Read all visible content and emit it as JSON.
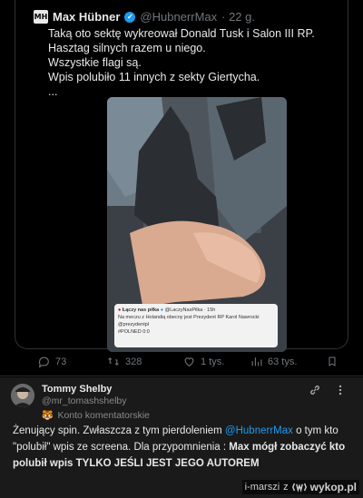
{
  "quoted": {
    "logo_text": "MH",
    "author": "Max Hübner",
    "handle": "@HubnerrMax",
    "time": "· 22 g.",
    "lines": [
      "Taką oto sektę wykreował Donald Tusk i Salon III RP.",
      "Hasztag silnych razem u niego.",
      "Wszystkie flagi są.",
      "Wpis polubiło 11 innych z sekty Giertycha.",
      "..."
    ]
  },
  "photo_card": {
    "author": "Łączy nas piłka",
    "handle": "@LaczyNasPilka · 15h",
    "text": "Na meczu z Holandią obecny jest Prezydent RP Karol Nawrocki @prezydentpl",
    "tag": "#POLNED 0:0"
  },
  "actions": {
    "replies": "73",
    "reposts": "328",
    "likes": "1 tys.",
    "views": "63 tys."
  },
  "comment": {
    "author": "Tommy Shelby",
    "handle": "@mr_tomashshelby",
    "account_type": "Konto komentatorskie",
    "text_1": "Żenujący spin. Zwłaszcza z tym pierdoleniem ",
    "mention": "@HubnerrMax",
    "text_2": " o tym kto \"polubił\" wpis ze screena. Dla przypomnienia : ",
    "bold_text": "Max mógł zobaczyć kto polubił wpis TYLKO JEŚLI JEST JEGO AUTOREM"
  },
  "footer": {
    "user": "i-marszi",
    "z": "z",
    "brand": "wykop.pl"
  }
}
